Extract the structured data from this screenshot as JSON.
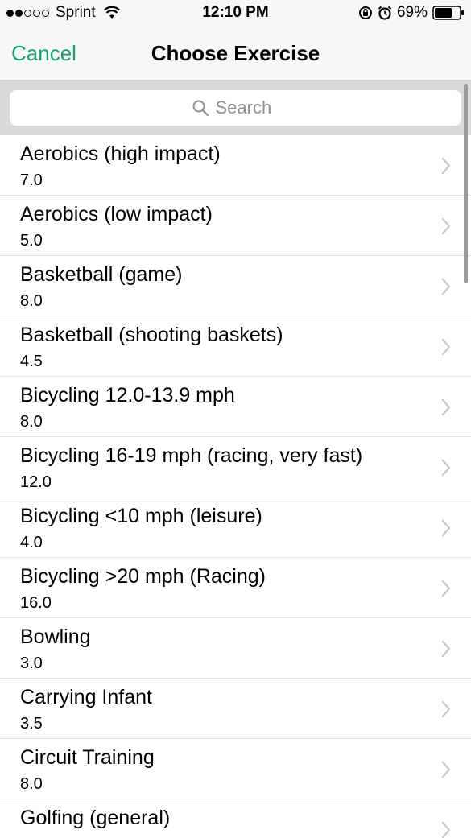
{
  "status_bar": {
    "carrier": "Sprint",
    "time": "12:10 PM",
    "battery": "69%",
    "signal_bars_full": 2,
    "signal_bars_total": 5,
    "icons": [
      "wifi-icon",
      "rotation-lock-icon",
      "alarm-icon",
      "battery-icon"
    ]
  },
  "nav": {
    "cancel_label": "Cancel",
    "title": "Choose Exercise",
    "accent_color": "#1a9f6e"
  },
  "search": {
    "placeholder": "Search"
  },
  "exercises": [
    {
      "name": "Aerobics (high impact)",
      "value": "7.0"
    },
    {
      "name": "Aerobics (low impact)",
      "value": "5.0"
    },
    {
      "name": "Basketball (game)",
      "value": "8.0"
    },
    {
      "name": "Basketball (shooting baskets)",
      "value": "4.5"
    },
    {
      "name": "Bicycling 12.0-13.9 mph",
      "value": "8.0"
    },
    {
      "name": "Bicycling 16-19 mph (racing, very fast)",
      "value": "12.0"
    },
    {
      "name": "Bicycling <10 mph (leisure)",
      "value": "4.0"
    },
    {
      "name": "Bicycling >20 mph (Racing)",
      "value": "16.0"
    },
    {
      "name": "Bowling",
      "value": "3.0"
    },
    {
      "name": "Carrying Infant",
      "value": "3.5"
    },
    {
      "name": "Circuit Training",
      "value": "8.0"
    },
    {
      "name": "Golfing (general)",
      "value": ""
    }
  ]
}
